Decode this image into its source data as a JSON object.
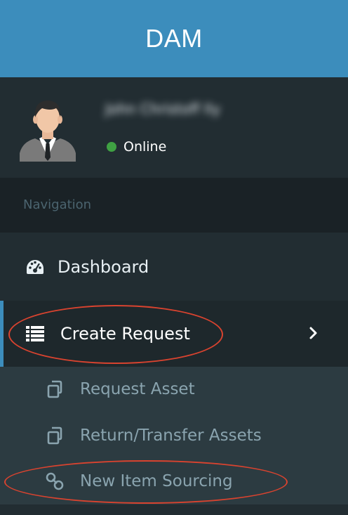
{
  "app": {
    "title": "DAM"
  },
  "user": {
    "name": "John Christoff Ily",
    "status": "Online"
  },
  "nav": {
    "header": "Navigation",
    "items": [
      {
        "label": "Dashboard",
        "icon": "dashboard-gauge-icon"
      },
      {
        "label": "Create Request",
        "icon": "list-icon",
        "expanded": true
      }
    ],
    "submenu": [
      {
        "label": "Request Asset",
        "icon": "copy-icon"
      },
      {
        "label": "Return/Transfer Assets",
        "icon": "copy-icon"
      },
      {
        "label": "New Item Sourcing",
        "icon": "link-icon"
      }
    ]
  },
  "colors": {
    "header_bg": "#3c8dbc",
    "sidebar_bg": "#222d32",
    "submenu_bg": "#2c3b41",
    "status_online": "#3fa143",
    "annotation": "#d9432f"
  }
}
